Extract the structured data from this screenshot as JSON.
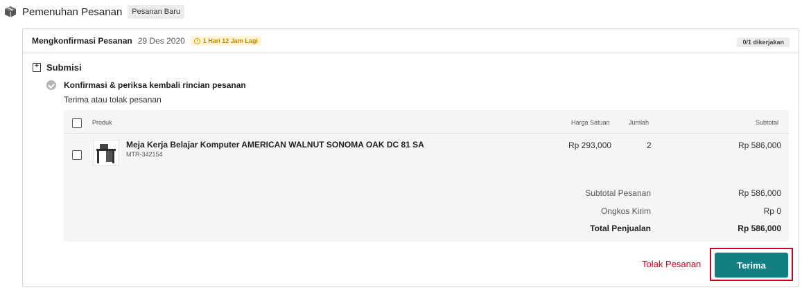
{
  "header": {
    "title": "Pemenuhan Pesanan",
    "status_tag": "Pesanan Baru",
    "icon": "box-icon"
  },
  "card": {
    "title": "Mengkonfirmasi Pesanan",
    "date": "29 Des 2020",
    "deadline": "1 Hari 12 Jam Lagi",
    "progress": "0/1 dikerjakan"
  },
  "submisi": {
    "label": "Submisi",
    "step_title": "Konfirmasi & periksa kembali rincian pesanan",
    "step_subtitle": "Terima atau tolak pesanan"
  },
  "table": {
    "headers": {
      "product": "Produk",
      "unit_price": "Harga Satuan",
      "quantity": "Jumlah",
      "subtotal": "Subtotal"
    },
    "rows": [
      {
        "name": "Meja Kerja Belajar Komputer AMERICAN WALNUT SONOMA OAK DC 81 SA",
        "sku": "MTR-342154",
        "unit_price": "Rp 293,000",
        "quantity": "2",
        "subtotal": "Rp 586,000"
      }
    ]
  },
  "summary": {
    "order_subtotal_label": "Subtotal Pesanan",
    "order_subtotal_value": "Rp 586,000",
    "shipping_label": "Ongkos Kirim",
    "shipping_value": "Rp 0",
    "total_label": "Total Penjualan",
    "total_value": "Rp 586,000"
  },
  "actions": {
    "reject_label": "Tolak Pesanan",
    "accept_label": "Terima"
  },
  "colors": {
    "accent": "#137f83",
    "danger": "#d0021b",
    "deadline_bg": "#fff5d6"
  }
}
